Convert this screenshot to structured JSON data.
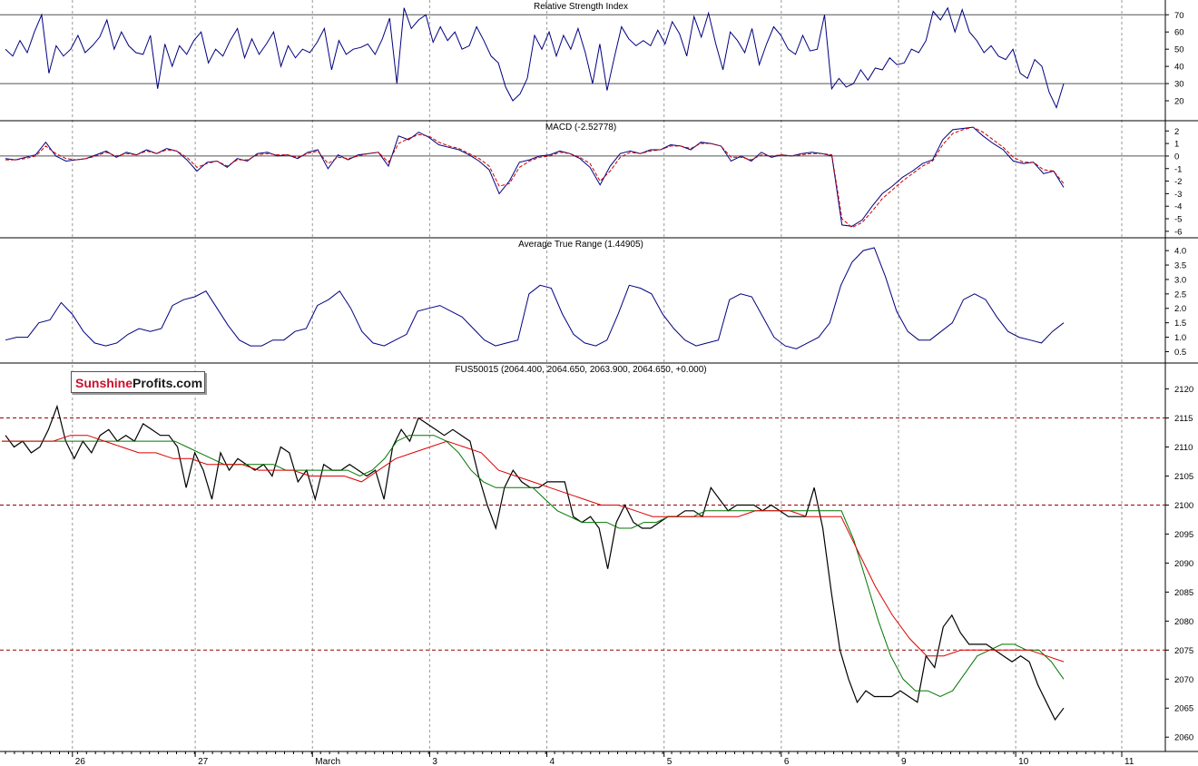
{
  "logo": {
    "part1": "Sunshine",
    "part2": "Profits.com"
  },
  "x_axis": {
    "labels": [
      {
        "text": "26",
        "pos": 0.06
      },
      {
        "text": "27",
        "pos": 0.17
      },
      {
        "text": "March",
        "pos": 0.275
      },
      {
        "text": "3",
        "pos": 0.38
      },
      {
        "text": "4",
        "pos": 0.485
      },
      {
        "text": "5",
        "pos": 0.59
      },
      {
        "text": "6",
        "pos": 0.695
      },
      {
        "text": "9",
        "pos": 0.8
      },
      {
        "text": "10",
        "pos": 0.905
      },
      {
        "text": "11",
        "pos": 1.0
      }
    ]
  },
  "colors": {
    "rsi": "#000080",
    "macd": "#000080",
    "signal": "#cc0000",
    "atr": "#000080",
    "price": "#000000",
    "ma_fast": "#007700",
    "ma_slow": "#dd0000",
    "level": "#990000",
    "grid": "#9a9a9a"
  },
  "chart_data": [
    {
      "type": "line",
      "title": "Relative Strength Index",
      "ylim": [
        10,
        77
      ],
      "yticks": [
        20,
        30,
        40,
        50,
        60,
        70
      ],
      "levels": [
        30,
        70
      ],
      "series": [
        {
          "values": [
            50,
            46,
            55,
            48,
            60,
            70,
            36,
            52,
            46,
            50,
            58,
            48,
            52,
            57,
            67,
            50,
            60,
            52,
            48,
            47,
            58,
            27,
            53,
            40,
            52,
            47,
            55,
            60,
            42,
            50,
            46,
            55,
            62,
            45,
            56,
            47,
            53,
            60,
            40,
            52,
            45,
            50,
            48,
            54,
            62,
            38,
            55,
            47,
            50,
            51,
            53,
            47,
            56,
            68,
            30,
            74,
            62,
            67,
            70,
            54,
            63,
            55,
            60,
            50,
            52,
            63,
            55,
            46,
            42,
            28,
            20,
            24,
            33,
            58,
            50,
            60,
            46,
            58,
            50,
            62,
            48,
            30,
            53,
            26,
            45,
            63,
            56,
            52,
            55,
            52,
            61,
            53,
            66,
            59,
            46,
            69,
            57,
            71,
            53,
            38,
            60,
            55,
            48,
            62,
            41,
            53,
            63,
            58,
            50,
            47,
            58,
            49,
            50,
            70,
            27,
            33,
            28,
            30,
            38,
            32,
            39,
            38,
            45,
            41,
            42,
            50,
            48,
            55,
            72,
            67,
            74,
            60,
            73,
            60,
            55,
            48,
            52,
            46,
            44,
            50,
            36,
            33,
            44,
            40,
            25,
            16,
            30
          ]
        }
      ]
    },
    {
      "type": "line",
      "title": "MACD (-2.52778)",
      "ylim": [
        -6.3,
        2.6
      ],
      "yticks": [
        -6,
        -5,
        -4,
        -3,
        -2,
        -1,
        0,
        1,
        2
      ],
      "levels": [
        0
      ],
      "series": [
        {
          "values": [
            -0.2,
            -0.3,
            -0.1,
            0.1,
            1.1,
            0.0,
            -0.4,
            -0.3,
            -0.2,
            0.1,
            0.4,
            -0.1,
            0.3,
            0.1,
            0.5,
            0.2,
            0.6,
            0.4,
            -0.3,
            -1.2,
            -0.5,
            -0.4,
            -0.9,
            -0.2,
            -0.4,
            0.2,
            0.3,
            0.0,
            0.1,
            -0.2,
            0.3,
            0.5,
            -1.0,
            0.1,
            -0.3,
            0.1,
            0.2,
            0.3,
            -0.8,
            1.6,
            1.3,
            1.9,
            1.5,
            0.9,
            0.7,
            0.5,
            0.1,
            -0.4,
            -1.1,
            -3.0,
            -2.0,
            -0.5,
            -0.3,
            0.0,
            0.1,
            0.4,
            0.2,
            -0.2,
            -0.9,
            -2.3,
            -0.8,
            0.2,
            0.4,
            0.2,
            0.5,
            0.5,
            0.9,
            0.8,
            0.5,
            1.1,
            1.0,
            0.8,
            -0.4,
            0.0,
            -0.4,
            0.3,
            -0.1,
            0.1,
            0.0,
            0.2,
            0.3,
            0.2,
            0.0,
            -5.5,
            -5.6,
            -5.1,
            -4.0,
            -3.0,
            -2.4,
            -1.7,
            -1.2,
            -0.6,
            -0.3,
            1.3,
            2.1,
            2.2,
            2.3,
            1.6,
            1.0,
            0.5,
            -0.4,
            -0.6,
            -0.5,
            -1.4,
            -1.2,
            -2.5
          ]
        },
        {
          "values": [
            -0.3,
            -0.3,
            -0.2,
            0.0,
            0.8,
            0.2,
            -0.2,
            -0.3,
            -0.2,
            0.0,
            0.3,
            0.0,
            0.2,
            0.1,
            0.4,
            0.2,
            0.5,
            0.4,
            -0.1,
            -0.9,
            -0.6,
            -0.4,
            -0.8,
            -0.3,
            -0.3,
            0.1,
            0.2,
            0.1,
            0.1,
            -0.1,
            0.2,
            0.4,
            -0.6,
            -0.1,
            -0.2,
            0.0,
            0.2,
            0.3,
            -0.5,
            1.0,
            1.4,
            1.7,
            1.6,
            1.1,
            0.8,
            0.6,
            0.2,
            -0.2,
            -0.8,
            -2.4,
            -2.2,
            -0.9,
            -0.4,
            -0.1,
            0.0,
            0.3,
            0.2,
            -0.1,
            -0.6,
            -2.0,
            -1.2,
            -0.1,
            0.3,
            0.2,
            0.4,
            0.5,
            0.8,
            0.8,
            0.6,
            1.0,
            1.0,
            0.8,
            -0.1,
            -0.1,
            -0.3,
            0.1,
            0.0,
            0.1,
            0.0,
            0.1,
            0.2,
            0.2,
            0.1,
            -5.0,
            -5.7,
            -5.3,
            -4.4,
            -3.4,
            -2.7,
            -2.0,
            -1.4,
            -0.8,
            -0.4,
            0.9,
            1.8,
            2.1,
            2.3,
            1.9,
            1.3,
            0.7,
            -0.1,
            -0.5,
            -0.5,
            -1.1,
            -1.2,
            -2.2
          ]
        }
      ]
    },
    {
      "type": "line",
      "title": "Average True Range (1.44905)",
      "ylim": [
        0.2,
        4.35
      ],
      "yticks": [
        0.5,
        1.0,
        1.5,
        2.0,
        2.5,
        3.0,
        3.5,
        4.0
      ],
      "series": [
        {
          "values": [
            0.9,
            1.0,
            1.0,
            1.5,
            1.6,
            2.2,
            1.8,
            1.2,
            0.8,
            0.7,
            0.8,
            1.1,
            1.3,
            1.2,
            1.3,
            2.1,
            2.3,
            2.4,
            2.6,
            2.0,
            1.4,
            0.9,
            0.7,
            0.7,
            0.9,
            0.9,
            1.2,
            1.3,
            2.1,
            2.3,
            2.6,
            2.0,
            1.2,
            0.8,
            0.7,
            0.9,
            1.1,
            1.9,
            2.0,
            2.1,
            1.9,
            1.7,
            1.3,
            0.9,
            0.7,
            0.8,
            0.9,
            2.5,
            2.8,
            2.7,
            1.8,
            1.1,
            0.8,
            0.7,
            0.9,
            1.8,
            2.8,
            2.7,
            2.5,
            1.8,
            1.3,
            0.9,
            0.7,
            0.8,
            0.9,
            2.3,
            2.5,
            2.4,
            1.7,
            1.0,
            0.7,
            0.6,
            0.8,
            1.0,
            1.5,
            2.8,
            3.6,
            4.0,
            4.1,
            3.1,
            1.9,
            1.2,
            0.9,
            0.9,
            1.2,
            1.5,
            2.3,
            2.5,
            2.3,
            1.7,
            1.2,
            1.0,
            0.9,
            0.8,
            1.2,
            1.5
          ]
        }
      ]
    },
    {
      "type": "line",
      "title": "FUS50015 (2064.400, 2064.650, 2063.900, 2064.650, +0.000)",
      "ylim": [
        2058,
        2124
      ],
      "yticks": [
        2060,
        2065,
        2070,
        2075,
        2080,
        2085,
        2090,
        2095,
        2100,
        2105,
        2110,
        2115,
        2120
      ],
      "levels": [
        2115,
        2100,
        2075
      ],
      "series": [
        {
          "name": "price",
          "values": [
            2112,
            2110,
            2111,
            2109,
            2110,
            2113,
            2117,
            2111,
            2108,
            2111,
            2109,
            2112,
            2113,
            2111,
            2112,
            2111,
            2114,
            2113,
            2112,
            2112,
            2110,
            2103,
            2109,
            2106,
            2101,
            2109,
            2106,
            2108,
            2107,
            2106,
            2107,
            2105,
            2110,
            2109,
            2104,
            2106,
            2101,
            2107,
            2106,
            2106,
            2107,
            2106,
            2105,
            2106,
            2101,
            2110,
            2113,
            2111,
            2115,
            2114,
            2113,
            2112,
            2113,
            2112,
            2111,
            2105,
            2100,
            2096,
            2103,
            2106,
            2104,
            2103,
            2103,
            2104,
            2104,
            2104,
            2098,
            2097,
            2098,
            2096,
            2089,
            2097,
            2100,
            2097,
            2096,
            2096,
            2097,
            2098,
            2098,
            2099,
            2099,
            2098,
            2103,
            2101,
            2099,
            2100,
            2100,
            2100,
            2099,
            2100,
            2099,
            2098,
            2098,
            2098,
            2103,
            2096,
            2085,
            2075,
            2070,
            2066,
            2068,
            2067,
            2067,
            2067,
            2068,
            2067,
            2066,
            2074,
            2072,
            2079,
            2081,
            2078,
            2076,
            2076,
            2076,
            2075,
            2074,
            2073,
            2074,
            2073,
            2069,
            2066,
            2063,
            2065
          ]
        },
        {
          "name": "ma_fast",
          "values": [
            2111,
            2111,
            2111,
            2111,
            2111,
            2111,
            2111,
            2111,
            2111,
            2111,
            2111,
            2111,
            2111,
            2111,
            2111,
            2110,
            2109,
            2108,
            2107,
            2107,
            2107,
            2107,
            2107,
            2106,
            2106,
            2106,
            2106,
            2106,
            2106,
            2105,
            2106,
            2108,
            2111,
            2112,
            2112,
            2112,
            2111,
            2109,
            2106,
            2104,
            2103,
            2103,
            2103,
            2103,
            2101,
            2099,
            2098,
            2097,
            2097,
            2097,
            2096,
            2096,
            2097,
            2097,
            2098,
            2098,
            2098,
            2099,
            2099,
            2099,
            2099,
            2099,
            2099,
            2099,
            2099,
            2099,
            2099,
            2099,
            2099,
            2094,
            2087,
            2080,
            2074,
            2070,
            2068,
            2068,
            2067,
            2068,
            2071,
            2074,
            2075,
            2076,
            2076,
            2075,
            2075,
            2073,
            2070
          ]
        },
        {
          "name": "ma_slow",
          "values": [
            2111,
            2111,
            2111,
            2111,
            2112,
            2112,
            2111,
            2110,
            2109,
            2109,
            2108,
            2108,
            2107,
            2107,
            2107,
            2106,
            2106,
            2106,
            2105,
            2105,
            2105,
            2104,
            2106,
            2108,
            2109,
            2110,
            2111,
            2110,
            2109,
            2106,
            2105,
            2104,
            2103,
            2102,
            2101,
            2100,
            2100,
            2099,
            2098,
            2098,
            2098,
            2098,
            2098,
            2098,
            2099,
            2099,
            2099,
            2098,
            2098,
            2098,
            2092,
            2086,
            2081,
            2077,
            2074,
            2074,
            2075,
            2075,
            2075,
            2075,
            2075,
            2074,
            2073
          ]
        }
      ]
    }
  ]
}
